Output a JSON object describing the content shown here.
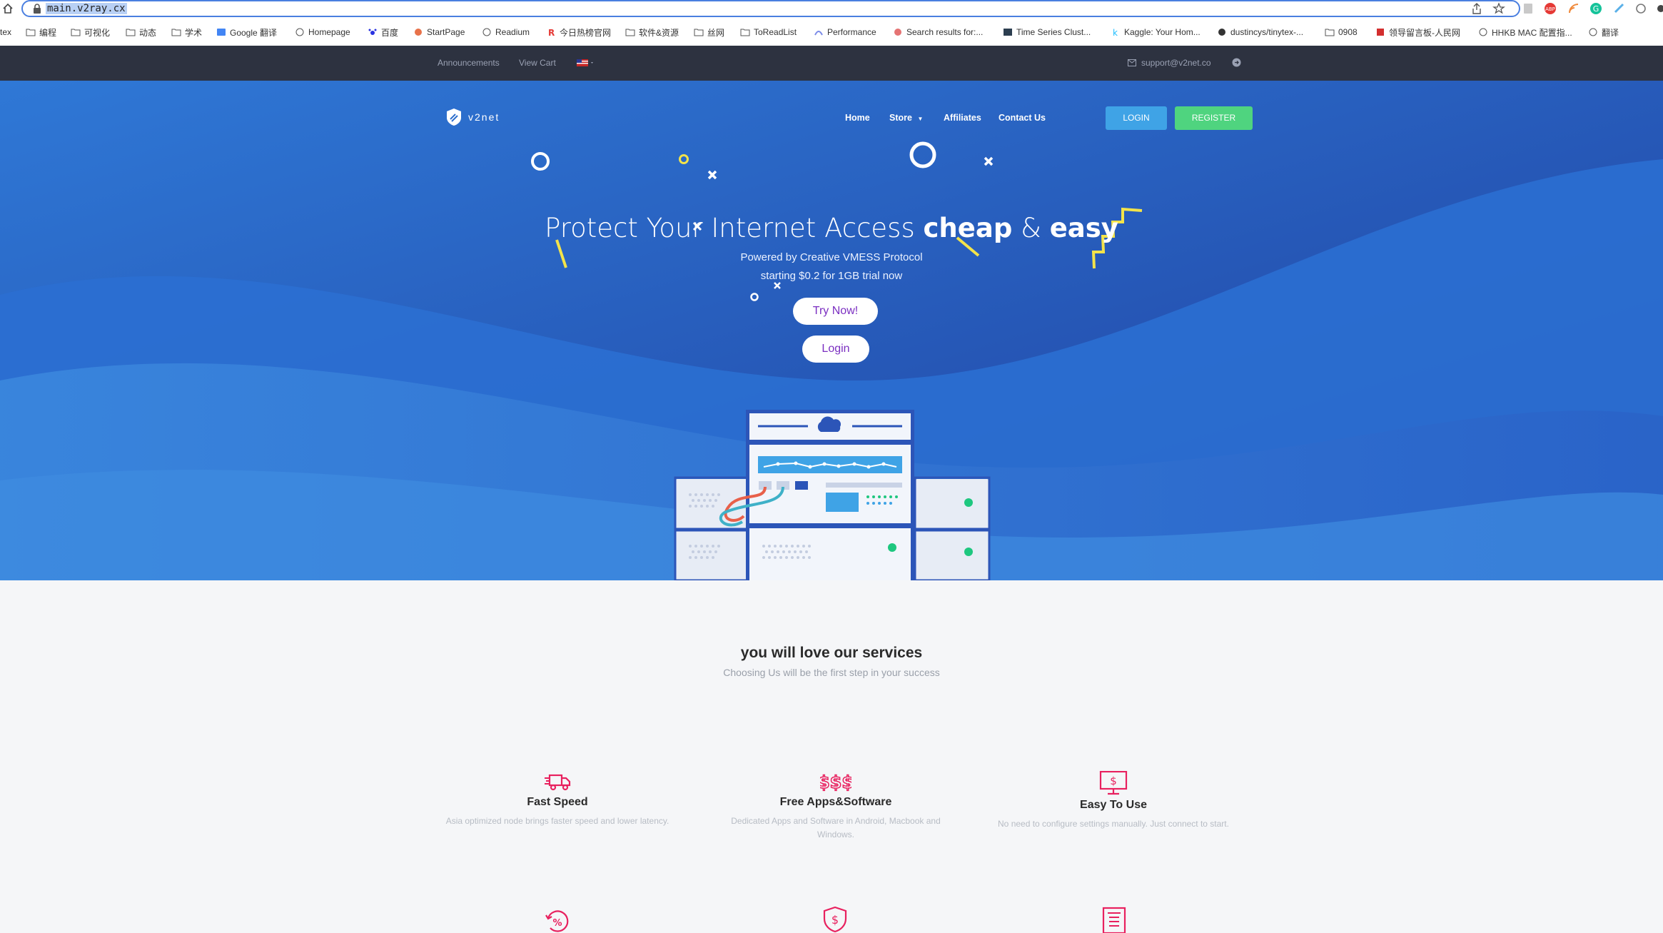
{
  "browser": {
    "url": "main.v2ray.cx",
    "bookmarks": [
      "tex",
      "编程",
      "可视化",
      "动态",
      "学术",
      "Google 翻译",
      "Homepage",
      "百度",
      "StartPage",
      "Readium",
      "今日热榜官网",
      "软件&资源",
      "丝网",
      "ToReadList",
      "Performance",
      "Search results for:...",
      "Time Series Clust...",
      "Kaggle: Your Hom...",
      "dustincys/tinytex-...",
      "0908",
      "领导留言板-人民网",
      "HHKB MAC 配置指...",
      "翻译"
    ]
  },
  "topbar": {
    "announcements": "Announcements",
    "view_cart": "View Cart",
    "email": "support@v2net.co"
  },
  "nav": {
    "brand": "v2net",
    "home": "Home",
    "store": "Store",
    "affiliates": "Affiliates",
    "contact": "Contact Us",
    "login": "LOGIN",
    "register": "REGISTER"
  },
  "hero": {
    "title_light": "Protect Your Internet Access ",
    "title_bold1": "cheap",
    "title_amp": " & ",
    "title_bold2": "easy",
    "subtitle1": "Powered by Creative VMESS Protocol",
    "subtitle2": "starting $0.2 for 1GB trial now",
    "try_now": "Try Now!",
    "login": "Login"
  },
  "services": {
    "title": "you will love our services",
    "subtitle": "Choosing Us will be the first step in your success",
    "features": [
      {
        "icon": "truck-icon",
        "title": "Fast Speed",
        "desc": "Asia optimized node brings faster speed and lower latency."
      },
      {
        "icon": "dollar-signs-icon",
        "title": "Free Apps&Software",
        "desc": "Dedicated Apps and Software in Android, Macbook and Windows."
      },
      {
        "icon": "monitor-dollar-icon",
        "title": "Easy To Use",
        "desc": "No need to configure settings manually. Just connect to start."
      }
    ]
  },
  "colors": {
    "accent_pink": "#e8215f",
    "login_blue": "#3fa3e6",
    "register_green": "#4fd47f",
    "hero_blue": "#2a6ccc",
    "topbar": "#2d3240"
  }
}
